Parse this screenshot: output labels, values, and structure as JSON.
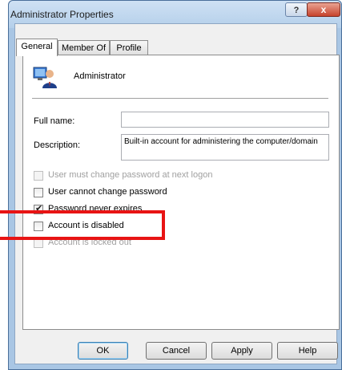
{
  "window": {
    "title": "Administrator Properties",
    "help_label": "?",
    "close_label": "x"
  },
  "tabs": [
    {
      "label": "General",
      "active": true
    },
    {
      "label": "Member Of",
      "active": false
    },
    {
      "label": "Profile",
      "active": false
    }
  ],
  "user": {
    "name": "Administrator",
    "icon": "user-computer-icon"
  },
  "fields": {
    "full_name": {
      "label": "Full name:",
      "value": ""
    },
    "description": {
      "label": "Description:",
      "value": "Built-in account for administering the computer/domain"
    }
  },
  "checkboxes": [
    {
      "label": "User must change password at next logon",
      "checked": false,
      "enabled": false
    },
    {
      "label": "User cannot change password",
      "checked": false,
      "enabled": true
    },
    {
      "label": "Password never expires",
      "checked": true,
      "enabled": true
    },
    {
      "label": "Account is disabled",
      "checked": false,
      "enabled": true
    },
    {
      "label": "Account is locked out",
      "checked": false,
      "enabled": false
    }
  ],
  "buttons": {
    "ok": "OK",
    "cancel": "Cancel",
    "apply": "Apply",
    "help": "Help"
  },
  "annotation": {
    "highlight_color": "#e81414"
  }
}
